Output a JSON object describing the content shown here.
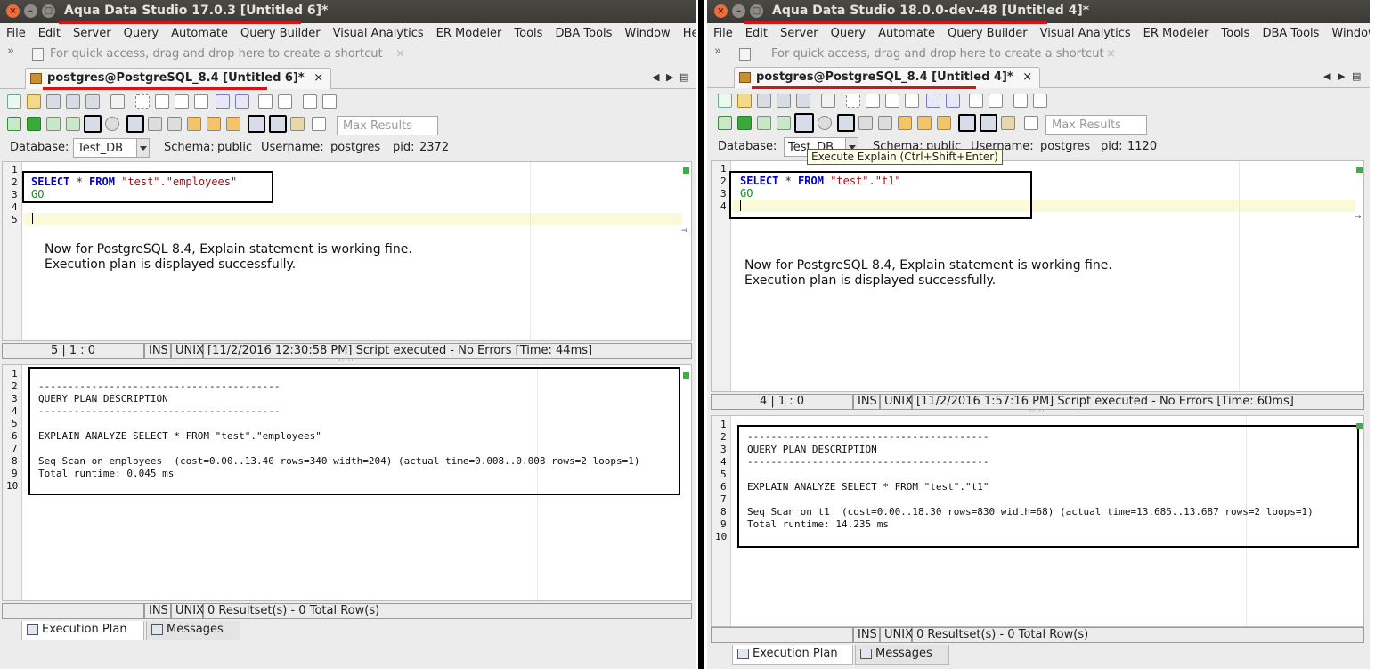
{
  "left": {
    "window_title": "Aqua Data Studio 17.0.3 [Untitled 6]*",
    "menu": [
      "File",
      "Edit",
      "Server",
      "Query",
      "Automate",
      "Query Builder",
      "Visual Analytics",
      "ER Modeler",
      "Tools",
      "DBA Tools",
      "Window",
      "Hel"
    ],
    "quick_access": "For quick access, drag and drop here to create a shortcut",
    "editor_tab": "postgres@PostgreSQL_8.4 [Untitled 6]*",
    "tab_close": "×",
    "max_results_placeholder": "Max Results",
    "database_label": "Database:",
    "database_value": "Test_DB",
    "schema_label": "Schema:",
    "schema_value": "public",
    "username_label": "Username:",
    "username_value": "postgres",
    "pid_label": "pid:",
    "pid_value": "2372",
    "line_numbers": [
      "1",
      "2",
      "3",
      "4",
      "5"
    ],
    "sql_keyword_select": "SELECT",
    "sql_star": " * ",
    "sql_keyword_from": "FROM",
    "sql_table": "\"test\".\"employees\"",
    "sql_go": "GO",
    "note_line1": "Now for PostgreSQL 8.4, Explain statement is working fine.",
    "note_line2": "Execution plan is displayed successfully.",
    "status_pos": "5 | 1 : 0",
    "status_ins": "INS",
    "status_unix": "UNIX",
    "status_msg": "[11/2/2016 12:30:58 PM] Script executed - No Errors [Time: 44ms]",
    "result_line_numbers": [
      "1",
      "2",
      "3",
      "4",
      "5",
      "6",
      "7",
      "8",
      "9",
      "10"
    ],
    "result_lines": [
      "",
      "-----------------------------------------",
      "QUERY PLAN DESCRIPTION",
      "-----------------------------------------",
      "",
      "EXPLAIN ANALYZE SELECT * FROM \"test\".\"employees\"",
      "",
      "Seq Scan on employees  (cost=0.00..13.40 rows=340 width=204) (actual time=0.008..0.008 rows=2 loops=1)",
      "Total runtime: 0.045 ms",
      ""
    ],
    "result_status_ins": "INS",
    "result_status_unix": "UNIX",
    "result_status_msg": "0 Resultset(s) - 0 Total Row(s)",
    "tab_plan": "Execution Plan",
    "tab_messages": "Messages"
  },
  "right": {
    "window_title": "Aqua Data Studio 18.0.0-dev-48 [Untitled 4]*",
    "menu": [
      "File",
      "Edit",
      "Server",
      "Query",
      "Automate",
      "Query Builder",
      "Visual Analytics",
      "ER Modeler",
      "Tools",
      "DBA Tools",
      "Window"
    ],
    "quick_access": "For quick access, drag and drop here to create a shortcut",
    "editor_tab": "postgres@PostgreSQL_8.4 [Untitled 4]*",
    "tab_close": "×",
    "max_results_placeholder": "Max Results",
    "database_label": "Database:",
    "database_value": "Test_DB",
    "schema_label": "Schema:",
    "schema_value": "public",
    "username_label": "Username:",
    "username_value": "postgres",
    "pid_label": "pid:",
    "pid_value": "1120",
    "tooltip": "Execute Explain (Ctrl+Shift+Enter)",
    "line_numbers": [
      "1",
      "2",
      "3",
      "4"
    ],
    "sql_keyword_select": "SELECT",
    "sql_star": " * ",
    "sql_keyword_from": "FROM",
    "sql_table": "\"test\".\"t1\"",
    "sql_go": "GO",
    "note_line1": "Now for PostgreSQL 8.4, Explain statement is working fine.",
    "note_line2": "Execution plan is displayed successfully.",
    "status_pos": "4 | 1 : 0",
    "status_ins": "INS",
    "status_unix": "UNIX",
    "status_msg": "[11/2/2016 1:57:16 PM] Script executed - No Errors [Time: 60ms]",
    "result_line_numbers": [
      "1",
      "2",
      "3",
      "4",
      "5",
      "6",
      "7",
      "8",
      "9",
      "10"
    ],
    "result_lines": [
      "",
      "-----------------------------------------",
      "QUERY PLAN DESCRIPTION",
      "-----------------------------------------",
      "",
      "EXPLAIN ANALYZE SELECT * FROM \"test\".\"t1\"",
      "",
      "Seq Scan on t1  (cost=0.00..18.30 rows=830 width=68) (actual time=13.685..13.687 rows=2 loops=1)",
      "Total runtime: 14.235 ms",
      ""
    ],
    "result_status_ins": "INS",
    "result_status_unix": "UNIX",
    "result_status_msg": "0 Resultset(s) - 0 Total Row(s)",
    "tab_plan": "Execution Plan",
    "tab_messages": "Messages"
  }
}
